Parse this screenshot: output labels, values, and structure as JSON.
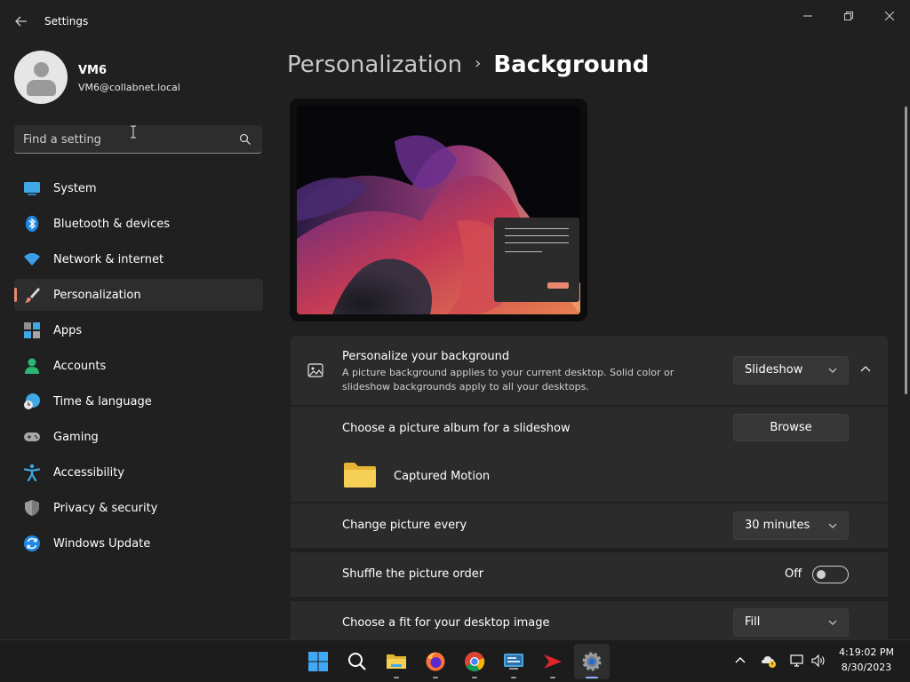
{
  "window": {
    "title": "Settings"
  },
  "profile": {
    "name": "VM6",
    "email": "VM6@collabnet.local"
  },
  "search": {
    "placeholder": "Find a setting"
  },
  "nav": {
    "items": [
      {
        "label": "System",
        "icon": "system-icon"
      },
      {
        "label": "Bluetooth & devices",
        "icon": "bluetooth-icon"
      },
      {
        "label": "Network & internet",
        "icon": "wifi-icon"
      },
      {
        "label": "Personalization",
        "icon": "brush-icon",
        "active": true
      },
      {
        "label": "Apps",
        "icon": "apps-icon"
      },
      {
        "label": "Accounts",
        "icon": "accounts-icon"
      },
      {
        "label": "Time & language",
        "icon": "time-language-icon"
      },
      {
        "label": "Gaming",
        "icon": "gamepad-icon"
      },
      {
        "label": "Accessibility",
        "icon": "accessibility-icon"
      },
      {
        "label": "Privacy & security",
        "icon": "shield-icon"
      },
      {
        "label": "Windows Update",
        "icon": "update-icon"
      }
    ]
  },
  "breadcrumb": {
    "parent": "Personalization",
    "separator": "›",
    "current": "Background"
  },
  "background": {
    "title": "Personalize your background",
    "description": "A picture background applies to your current desktop. Solid color or slideshow backgrounds apply to all your desktops.",
    "type_value": "Slideshow",
    "album_label": "Choose a picture album for a slideshow",
    "browse_label": "Browse",
    "album_name": "Captured Motion",
    "interval_label": "Change picture every",
    "interval_value": "30 minutes",
    "shuffle_label": "Shuffle the picture order",
    "shuffle_state": "Off",
    "fit_label": "Choose a fit for your desktop image",
    "fit_value": "Fill"
  },
  "taskbar": {
    "apps": [
      "start-icon",
      "search-icon",
      "file-explorer-icon",
      "firefox-icon",
      "chrome-icon",
      "remote-desktop-icon",
      "app-icon",
      "settings-icon"
    ],
    "time": "4:19:02 PM",
    "date": "8/30/2023"
  },
  "colors": {
    "accent": "#e8896f",
    "background": "#202020",
    "card": "#2b2b2b"
  }
}
